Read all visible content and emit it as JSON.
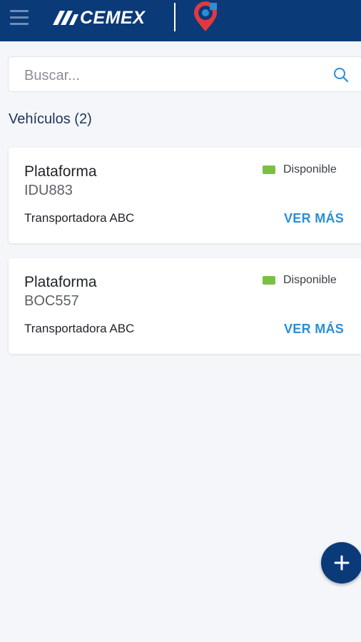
{
  "header": {
    "brand": "CEMEX",
    "menu_icon": "hamburger-menu-icon",
    "app_icon": "location-pin-icon"
  },
  "search": {
    "placeholder": "Buscar...",
    "value": "",
    "icon": "search-icon"
  },
  "vehicles": {
    "title": "Vehículos (2)",
    "items": [
      {
        "type": "Plataforma",
        "plate": "IDU883",
        "company": "Transportadora ABC",
        "status": "Disponible",
        "status_color": "#7ac143",
        "action": "VER MÁS"
      },
      {
        "type": "Plataforma",
        "plate": "BOC557",
        "company": "Transportadora ABC",
        "status": "Disponible",
        "status_color": "#7ac143",
        "action": "VER MÁS"
      }
    ]
  },
  "fab": {
    "icon": "plus-icon"
  },
  "colors": {
    "header_bg": "#0b3a78",
    "accent": "#2a8fd4",
    "status_ok": "#7ac143",
    "page_bg": "#f4f6fa"
  }
}
